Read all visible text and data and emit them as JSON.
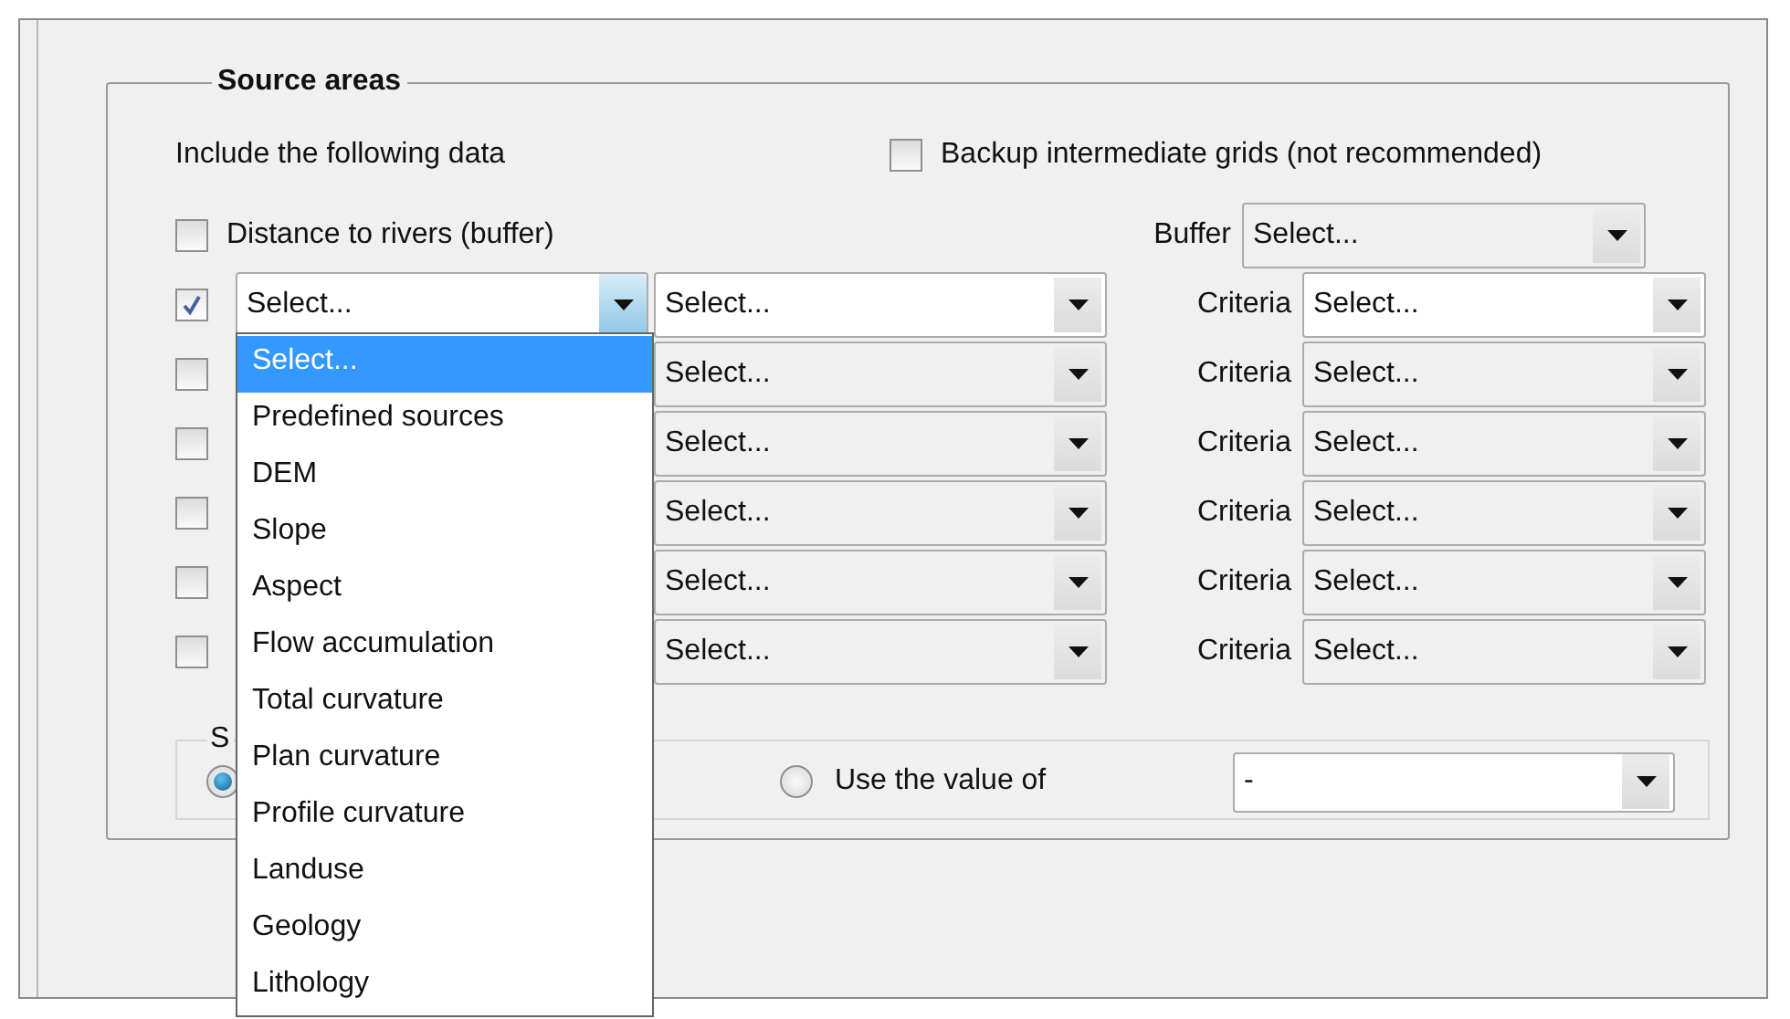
{
  "group": {
    "title": "Source areas",
    "include_label": "Include the following data",
    "backup": {
      "label": "Backup intermediate grids (not recommended)",
      "checked": false
    },
    "buffer_row": {
      "label": "Distance to rivers (buffer)",
      "checked": false,
      "field_label": "Buffer",
      "value": "Select..."
    },
    "rows": [
      {
        "checked": true,
        "source": "Select...",
        "source_expanded": true,
        "option": "Select...",
        "criteria_label": "Criteria",
        "criteria": "Select..."
      },
      {
        "checked": false,
        "option": "Select...",
        "criteria_label": "Criteria",
        "criteria": "Select..."
      },
      {
        "checked": false,
        "option": "Select...",
        "criteria_label": "Criteria",
        "criteria": "Select..."
      },
      {
        "checked": false,
        "option": "Select...",
        "criteria_label": "Criteria",
        "criteria": "Select..."
      },
      {
        "checked": false,
        "option": "Select...",
        "criteria_label": "Criteria",
        "criteria": "Select..."
      },
      {
        "checked": false,
        "option": "Select...",
        "criteria_label": "Criteria",
        "criteria": "Select..."
      }
    ],
    "value_group": {
      "title": "S",
      "options": [
        {
          "selected": true
        },
        {
          "label": "Use the value of",
          "selected": false
        }
      ],
      "value": "-"
    }
  },
  "dropdown_list": {
    "items": [
      {
        "label": "Select...",
        "selected": true
      },
      {
        "label": "Predefined sources",
        "selected": false
      },
      {
        "label": "DEM",
        "selected": false
      },
      {
        "label": "Slope",
        "selected": false
      },
      {
        "label": "Aspect",
        "selected": false
      },
      {
        "label": "Flow accumulation",
        "selected": false
      },
      {
        "label": "Total curvature",
        "selected": false
      },
      {
        "label": "Plan curvature",
        "selected": false
      },
      {
        "label": "Profile curvature",
        "selected": false
      },
      {
        "label": "Landuse",
        "selected": false
      },
      {
        "label": "Geology",
        "selected": false
      },
      {
        "label": "Lithology",
        "selected": false
      }
    ]
  }
}
